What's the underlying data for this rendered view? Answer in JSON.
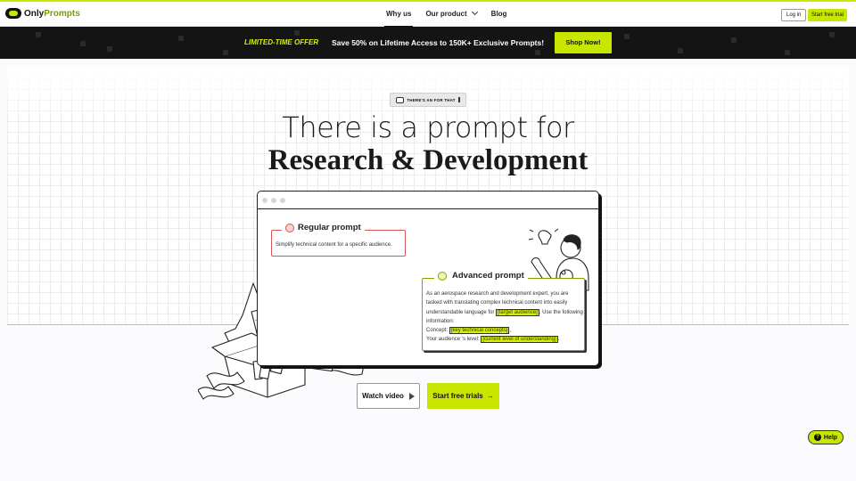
{
  "nav": {
    "brand_part1": "Only",
    "brand_part2": "Prompts",
    "links": [
      {
        "label": "Why us",
        "active": true
      },
      {
        "label": "Our product",
        "has_dropdown": true
      },
      {
        "label": "Blog"
      }
    ],
    "login_label": "Log in",
    "trial_label": "Start free trial"
  },
  "banner": {
    "tag": "LIMITED-TIME OFFER",
    "text": "Save 50% on Lifetime Access to 150K+ Exclusive Prompts!",
    "button_label": "Shop Now!"
  },
  "hero": {
    "badge": "THERE'S AN  FOR THAT",
    "line1": "There is a prompt for",
    "line2": "Research & Development"
  },
  "regular_prompt": {
    "title": "Regular prompt",
    "body": "Simplify technical content for a specific audience."
  },
  "advanced_prompt": {
    "title": "Advanced prompt",
    "intro": "As an aerospace research and development expert, you are tasked with translating complex technical content into easily understandable language for",
    "var_audience": "[target audience]",
    "after_audience": ". Use the following information:",
    "concept_label": "Concept:",
    "var_concepts": "[key technical concepts]",
    "level_label": "Your audience 's level:",
    "var_level": "[current level of understanding]"
  },
  "cta": {
    "watch_label": "Watch video",
    "start_label": "Start free trials"
  },
  "help_label": "Help",
  "colors": {
    "accent": "#c8e600",
    "banner_bg": "#141414",
    "regular_border": "#d95454",
    "advanced_border": "#7fa300"
  }
}
